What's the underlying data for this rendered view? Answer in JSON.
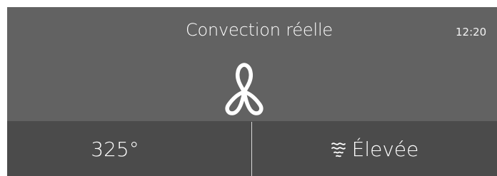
{
  "header": {
    "mode_title": "Convection réelle",
    "clock": "12:20"
  },
  "icons": {
    "mode_icon": "fan-icon",
    "level_icon": "heat-waves-icon"
  },
  "controls": {
    "temperature": "325°",
    "fan_level": "Élevée"
  },
  "colors": {
    "top_panel": "#626262",
    "bottom_bar": "#4b4b4b",
    "text": "#ffffff"
  }
}
